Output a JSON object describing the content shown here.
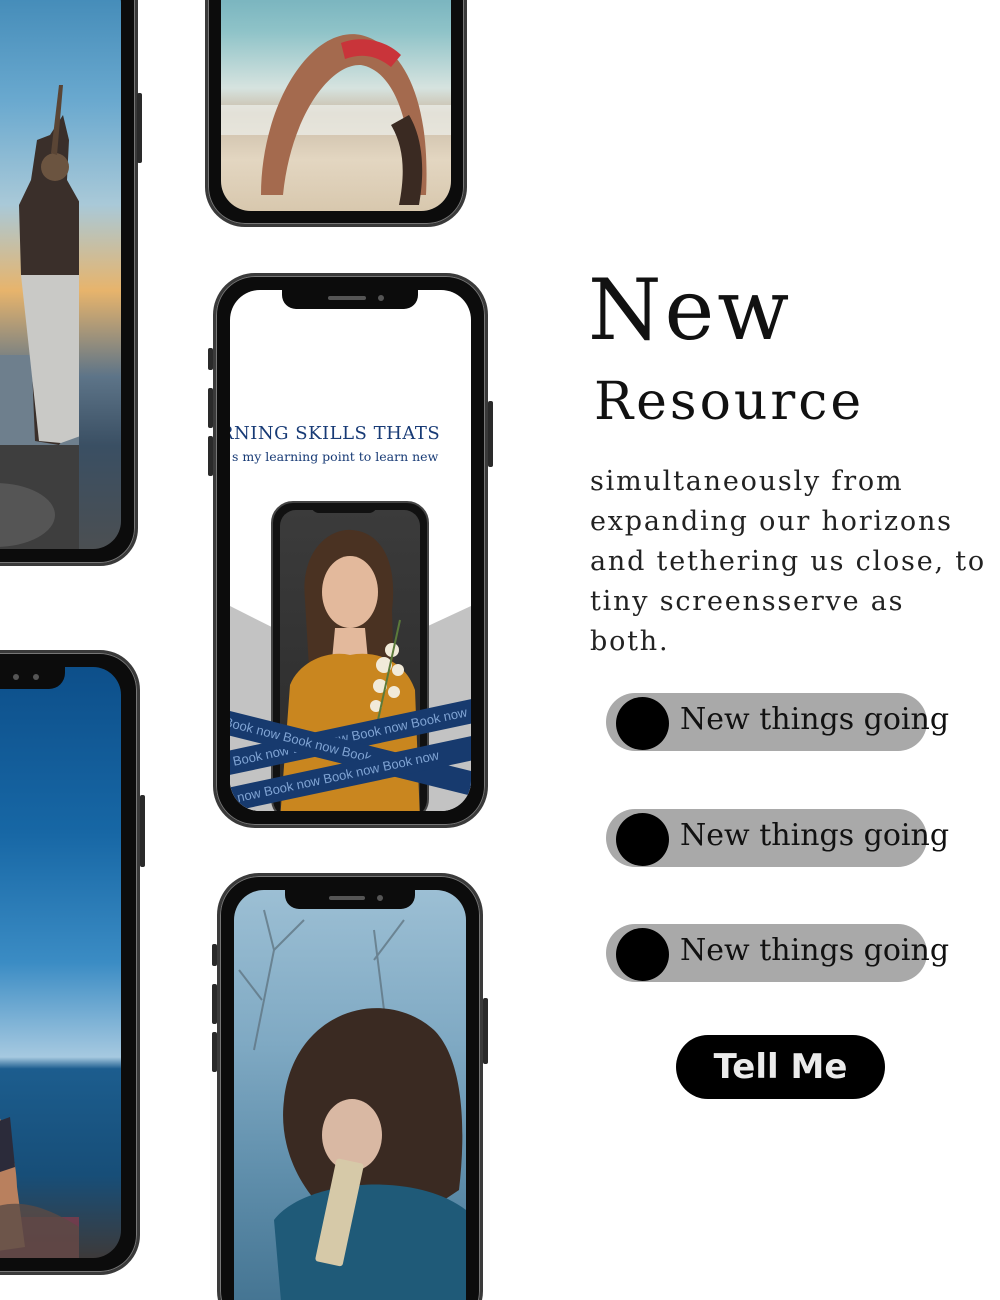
{
  "hero": {
    "headline": "New",
    "subheadline": "Resource",
    "body": "simultaneously from expanding our horizons and tethering us close, to tiny screensserve as both."
  },
  "options": [
    {
      "label": "New things going"
    },
    {
      "label": "New things going"
    },
    {
      "label": "New things going"
    }
  ],
  "cta": {
    "label": "Tell Me"
  },
  "learning_app": {
    "title": "RNING SKILLS THATS",
    "subtitle": "s my learning point to learn new",
    "ribbon_top": "ow   Book now  Book now  Book now  Book now",
    "ribbon_mid": "Book now  Book now  Book now",
    "ribbon_bottom": "ook now  Book now  Book now  Book now"
  },
  "colors": {
    "background": "#ffffff",
    "text": "#111111",
    "pill": "#a9a9a9",
    "knob": "#000000",
    "cta_bg": "#000000",
    "cta_text": "#ebebeb",
    "app_accent": "#173a75"
  },
  "icons": {
    "toggle_knob": "toggle-knob-icon"
  }
}
